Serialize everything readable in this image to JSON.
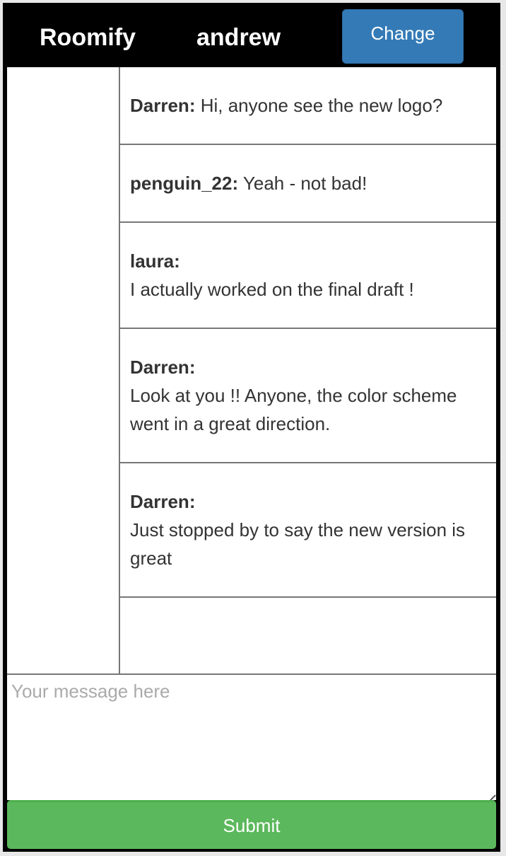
{
  "header": {
    "brand": "Roomify",
    "username": "andrew",
    "change_label": "Change"
  },
  "messages": [
    {
      "author": "Darren:",
      "text": "Hi, anyone see the new logo?",
      "inline": true
    },
    {
      "author": "penguin_22:",
      "text": "Yeah - not bad!",
      "inline": true
    },
    {
      "author": "laura:",
      "text": "I actually worked on the final draft !",
      "inline": false
    },
    {
      "author": "Darren:",
      "text": "Look at you !! Anyone, the color scheme went in a great direction.",
      "inline": false
    },
    {
      "author": "Darren:",
      "text": "Just stopped by to say the new version is great",
      "inline": false
    }
  ],
  "composer": {
    "placeholder": "Your message here",
    "value": ""
  },
  "submit_label": "Submit"
}
